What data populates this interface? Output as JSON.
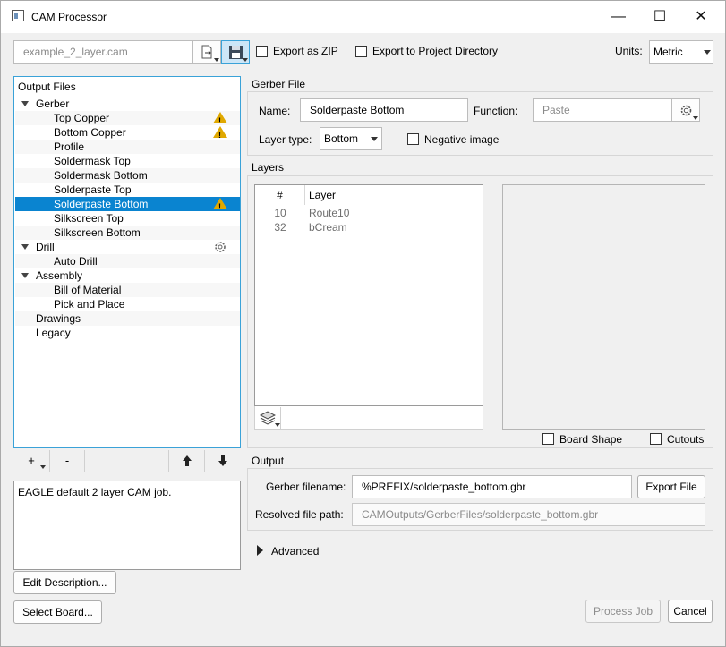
{
  "window": {
    "title": "CAM Processor",
    "minimize_glyph": "—",
    "maximize_glyph": "☐",
    "close_glyph": "✕"
  },
  "toolbar": {
    "filename": "example_2_layer.cam",
    "export_zip_label": "Export as ZIP",
    "export_project_dir_label": "Export to Project Directory",
    "units_label": "Units:",
    "units_value": "Metric",
    "icons": [
      "open-file-icon",
      "save-icon"
    ]
  },
  "output_files": {
    "header": "Output Files",
    "items": [
      {
        "label": "Gerber",
        "level": 0,
        "expandable": true
      },
      {
        "label": "Top Copper",
        "level": 1,
        "warning": true
      },
      {
        "label": "Bottom Copper",
        "level": 1,
        "warning": true
      },
      {
        "label": "Profile",
        "level": 1
      },
      {
        "label": "Soldermask Top",
        "level": 1
      },
      {
        "label": "Soldermask Bottom",
        "level": 1
      },
      {
        "label": "Solderpaste Top",
        "level": 1
      },
      {
        "label": "Solderpaste Bottom",
        "level": 1,
        "warning": true,
        "selected": true
      },
      {
        "label": "Silkscreen Top",
        "level": 1
      },
      {
        "label": "Silkscreen Bottom",
        "level": 1
      },
      {
        "label": "Drill",
        "level": 0,
        "expandable": true,
        "gear": true
      },
      {
        "label": "Auto Drill",
        "level": 1
      },
      {
        "label": "Assembly",
        "level": 0,
        "expandable": true
      },
      {
        "label": "Bill of Material",
        "level": 1
      },
      {
        "label": "Pick and Place",
        "level": 1
      },
      {
        "label": "Drawings",
        "level": 0
      },
      {
        "label": "Legacy",
        "level": 0
      }
    ],
    "add_label": "+",
    "remove_label": "-"
  },
  "description": {
    "text": "EAGLE default 2 layer CAM job.",
    "edit_button": "Edit Description...",
    "select_board_button": "Select Board..."
  },
  "gerber_file": {
    "section_title": "Gerber File",
    "name_label": "Name:",
    "name_value": "Solderpaste Bottom",
    "function_label": "Function:",
    "function_value": "Paste",
    "layer_type_label": "Layer type:",
    "layer_type_value": "Bottom",
    "negative_image_label": "Negative image"
  },
  "layers": {
    "section_title": "Layers",
    "columns": [
      "#",
      "Layer"
    ],
    "rows": [
      {
        "num": "10",
        "name": "Route10"
      },
      {
        "num": "32",
        "name": "bCream"
      }
    ],
    "board_shape_label": "Board Shape",
    "cutouts_label": "Cutouts"
  },
  "output": {
    "section_title": "Output",
    "gerber_filename_label": "Gerber filename:",
    "gerber_filename_value": "%PREFIX/solderpaste_bottom.gbr",
    "export_file_button": "Export File",
    "resolved_path_label": "Resolved file path:",
    "resolved_path_value": "CAMOutputs/GerberFiles/solderpaste_bottom.gbr",
    "advanced_label": "Advanced"
  },
  "footer": {
    "process_job_button": "Process Job",
    "cancel_button": "Cancel"
  },
  "colors": {
    "selection": "#0a84d0",
    "tree_border": "#3aa2d8",
    "warning": "#e0a800"
  }
}
